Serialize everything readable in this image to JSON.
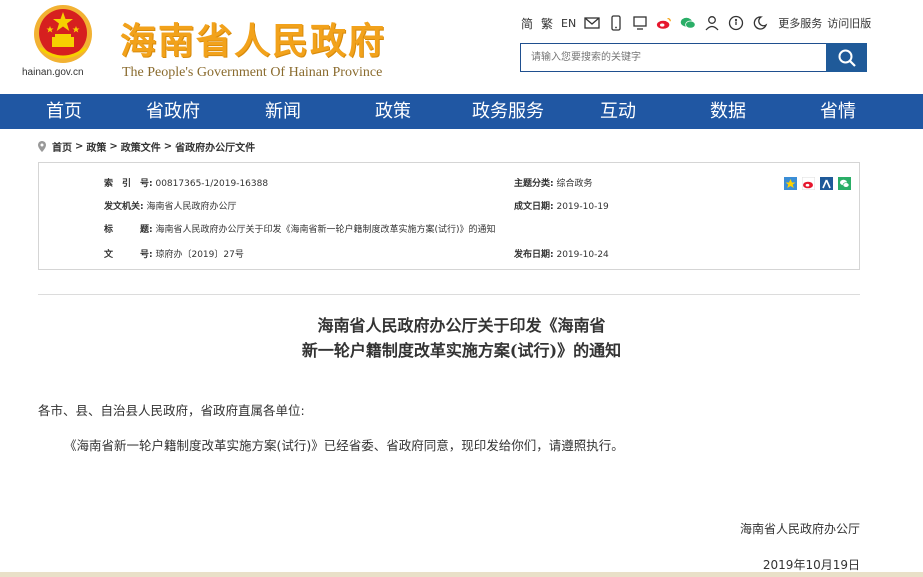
{
  "header": {
    "title_cn": "海南省人民政府",
    "title_en": "The People's Government Of Hainan Province",
    "domain": "hainan.gov.cn",
    "emblem_icon": "national-emblem-icon"
  },
  "topbar": {
    "simplified": "简",
    "traditional": "繁",
    "english": "EN",
    "icons": [
      "mail-icon",
      "mobile-icon",
      "weibo-icon",
      "wechat-icon",
      "user-icon",
      "accessibility-icon",
      "elderly-mode-icon"
    ],
    "more_services": "更多服务",
    "old_version": "访问旧版"
  },
  "search": {
    "placeholder": "请输入您要搜索的关键字"
  },
  "nav": {
    "items": [
      "首页",
      "省政府",
      "新闻",
      "政策",
      "政务服务",
      "互动",
      "数据",
      "省情"
    ]
  },
  "breadcrumb": {
    "items": [
      "首页",
      "政策",
      "政策文件",
      "省政府办公厅文件"
    ]
  },
  "info": {
    "index_label": "索　引　号:",
    "index_value": "00817365-1/2019-16388",
    "subject_label": "主题分类:",
    "subject_value": "综合政务",
    "issuer_label": "发文机关:",
    "issuer_value": "海南省人民政府办公厅",
    "created_label": "成文日期:",
    "created_value": "2019-10-19",
    "title_label": "标　　　题:",
    "title_value": "海南省人民政府办公厅关于印发《海南省新一轮户籍制度改革实施方案(试行)》的通知",
    "docno_label": "文　　　号:",
    "docno_value": "琼府办〔2019〕27号",
    "published_label": "发布日期:",
    "published_value": "2019-10-24"
  },
  "doc": {
    "title_line1": "海南省人民政府办公厅关于印发《海南省",
    "title_line2": "新一轮户籍制度改革实施方案(试行)》的通知",
    "salutation": "各市、县、自治县人民政府，省政府直属各单位:",
    "body": "《海南省新一轮户籍制度改革实施方案(试行)》已经省委、省政府同意，现印发给你们，请遵照执行。",
    "signer": "海南省人民政府办公厅",
    "date": "2019年10月19日"
  },
  "colors": {
    "nav_bg": "#2057a3",
    "title_gold": "#f2a21b",
    "emblem_red": "#d61f1f"
  }
}
